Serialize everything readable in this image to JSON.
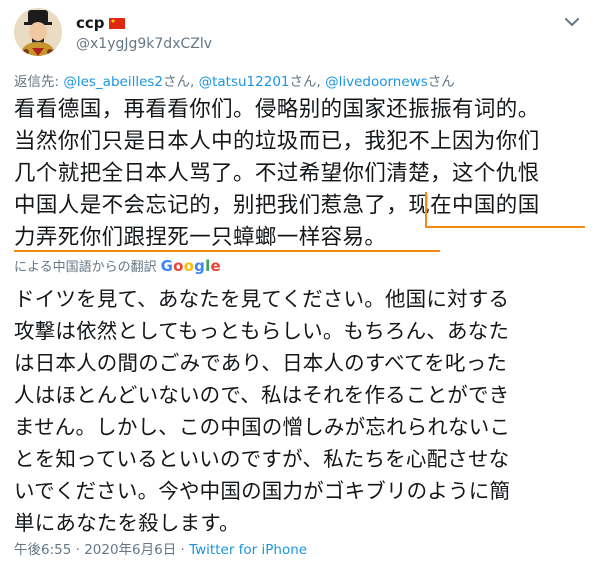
{
  "user": {
    "display_name": "ccp",
    "handle": "@x1ygJg9k7dxCZlv",
    "avatar_icon": "emperor-portrait-avatar",
    "flag_icon": "china-flag-icon"
  },
  "reply": {
    "prefix": "返信先: ",
    "mentions": [
      "@les_abeilles2",
      "@tatsu12201",
      "@livedoornews"
    ],
    "suffixes": [
      "さん, ",
      "さん, ",
      "さん"
    ]
  },
  "original_text": {
    "lines": [
      "看看德国，再看看你们。侵略别的国家还振振有词的。",
      "当然你们只是日本人中的垃圾而已，我犯不上因为你们",
      "几个就把全日本人骂了。不过希望你们清楚，这个仇恨",
      "中国人是不会忘记的，别把我们惹急了，现在中国的国",
      "力弄死你们跟捏死一只蟑螂一样容易。"
    ],
    "highlight_color": "#f28a16"
  },
  "translation": {
    "label": "による中国語からの翻訳",
    "provider_letters": [
      "G",
      "o",
      "o",
      "g",
      "l",
      "e"
    ],
    "provider_colors": [
      "#4285f4",
      "#ea4335",
      "#fbbc05",
      "#4285f4",
      "#34a853",
      "#ea4335"
    ]
  },
  "translated_text": {
    "lines": [
      "ドイツを見て、あなたを見てください。他国に対する",
      "攻撃は依然としてもっともらしい。もちろん、あなた",
      "は日本人の間のごみであり、日本人のすべてを叱った",
      "人はほとんどいないので、私はそれを作ることができ",
      "ません。しかし、この中国の憎しみが忘れられないこ",
      "とを知っているといいのですが、私たちを心配させな",
      "いでください。今や中国の国力がゴキブリのように簡",
      "単にあなたを殺します。"
    ]
  },
  "meta": {
    "time": "午後6:55",
    "separator": " · ",
    "date": "2020年6月6日",
    "source": "Twitter for iPhone"
  },
  "colors": {
    "link": "#1b95e0",
    "secondary_text": "#657786",
    "primary_text": "#14171a"
  }
}
